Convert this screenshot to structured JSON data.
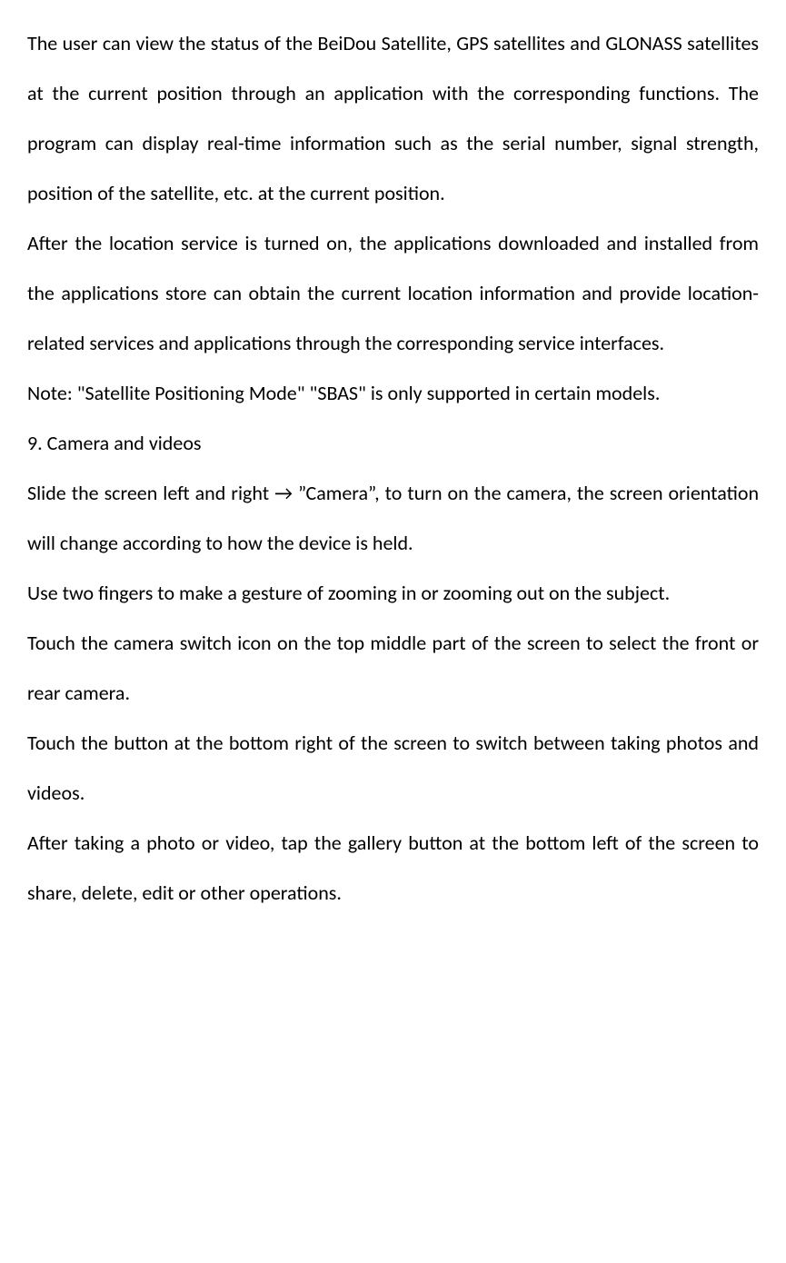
{
  "paragraphs": {
    "p1": "The user can view the status of the BeiDou Satellite, GPS satellites and GLONASS satellites at the current position through an application with the corresponding functions. The program can display real-time information such as the serial number, signal strength, position of the satellite, etc. at the current position.",
    "p2": "After the location service is turned on, the applications downloaded and installed from the applications store can obtain the current location information and provide location-related services and applications through the corresponding service interfaces.",
    "p3": "Note: \"Satellite Positioning Mode\" \"SBAS\" is only supported in certain models.",
    "heading": "9. Camera and videos",
    "p4_part1": "Slide the screen left and right ",
    "p4_arrow": "→",
    "p4_part2": " ”Camera”, to turn on the camera, the screen orientation will change according to how the device is held.",
    "p5": "Use two fingers to make a gesture of zooming in or zooming out on the subject.",
    "p6": "Touch the camera switch icon on the top middle part of the screen to select the front or rear camera.",
    "p7": "Touch the button at the bottom right of the screen to switch between taking photos and videos.",
    "p8": "After taking a photo or video, tap the gallery button at the bottom left of the screen to share, delete, edit or other operations."
  }
}
